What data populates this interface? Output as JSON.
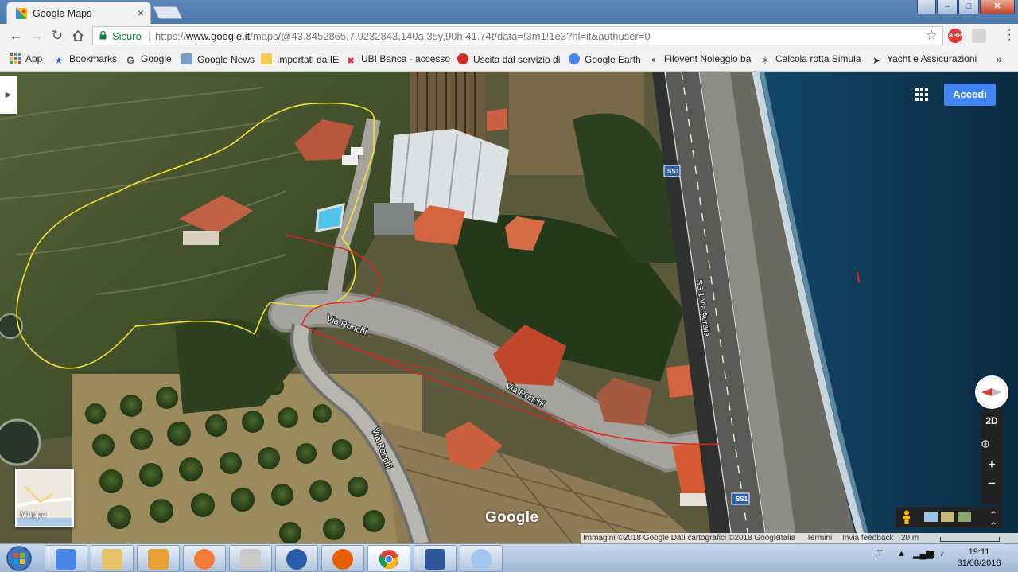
{
  "browser": {
    "tab_title": "Google Maps",
    "tab_close": "×",
    "window_buttons": [
      "–",
      "□",
      "✕"
    ],
    "secure_label": "Sicuro",
    "url_prefix": "https://",
    "url_host": "www.google.it",
    "url_rest": "/maps/@43.8452865,7.9232843,140a,35y,90h,41.74t/data=!3m1!1e3?hl=it&authuser=0",
    "star": "☆"
  },
  "bookmarks": [
    {
      "label": "App",
      "icon": "apps-grid-icon"
    },
    {
      "label": "Bookmarks",
      "icon": "star-icon"
    },
    {
      "label": "Google",
      "icon": "google-g-icon"
    },
    {
      "label": "Google News",
      "icon": "news-icon"
    },
    {
      "label": "Importati da IE",
      "icon": "folder-icon"
    },
    {
      "label": "UBI Banca - accesso",
      "icon": "ubi-icon"
    },
    {
      "label": "Uscita dal servizio di",
      "icon": "red-circle-icon"
    },
    {
      "label": "Google Earth",
      "icon": "earth-icon"
    },
    {
      "label": "Filovent Noleggio ba",
      "icon": "pin-icon"
    },
    {
      "label": "Calcola rotta Simula",
      "icon": "compass-rose-icon"
    },
    {
      "label": "Yacht e Assicurazioni",
      "icon": "boat-icon"
    }
  ],
  "bookmarks_more": "»",
  "map": {
    "accedi_label": "Accedi",
    "minimap_label": "Mappa",
    "google_logo": "Google",
    "road_labels": [
      "Via Ronchi",
      "Via Ronchi",
      "Via Ronchi",
      "SS 1 Via Aurelia",
      "SS1",
      "SS1"
    ],
    "controls": {
      "mode_2d": "2D",
      "zoom_in": "+",
      "zoom_out": "−"
    },
    "attribution": {
      "imagery": "Immagini ©2018 Google,Dati cartografici ©2018 Google",
      "country": "Italia",
      "terms": "Termini",
      "feedback": "Invia feedback",
      "scale": "20 m"
    },
    "colors": {
      "annotation_yellow": "#f2e233",
      "annotation_red": "#e0231c",
      "sea": "#0e3550",
      "accent_blue": "#4285f4"
    }
  },
  "taskbar": {
    "apps": [
      "windows-start",
      "google-translate",
      "file-explorer",
      "outlook",
      "media-player",
      "usb-tool",
      "thunderbird",
      "firefox",
      "chrome",
      "word",
      "paint"
    ],
    "language": "IT",
    "time": "19:11",
    "date": "31/08/2018"
  }
}
